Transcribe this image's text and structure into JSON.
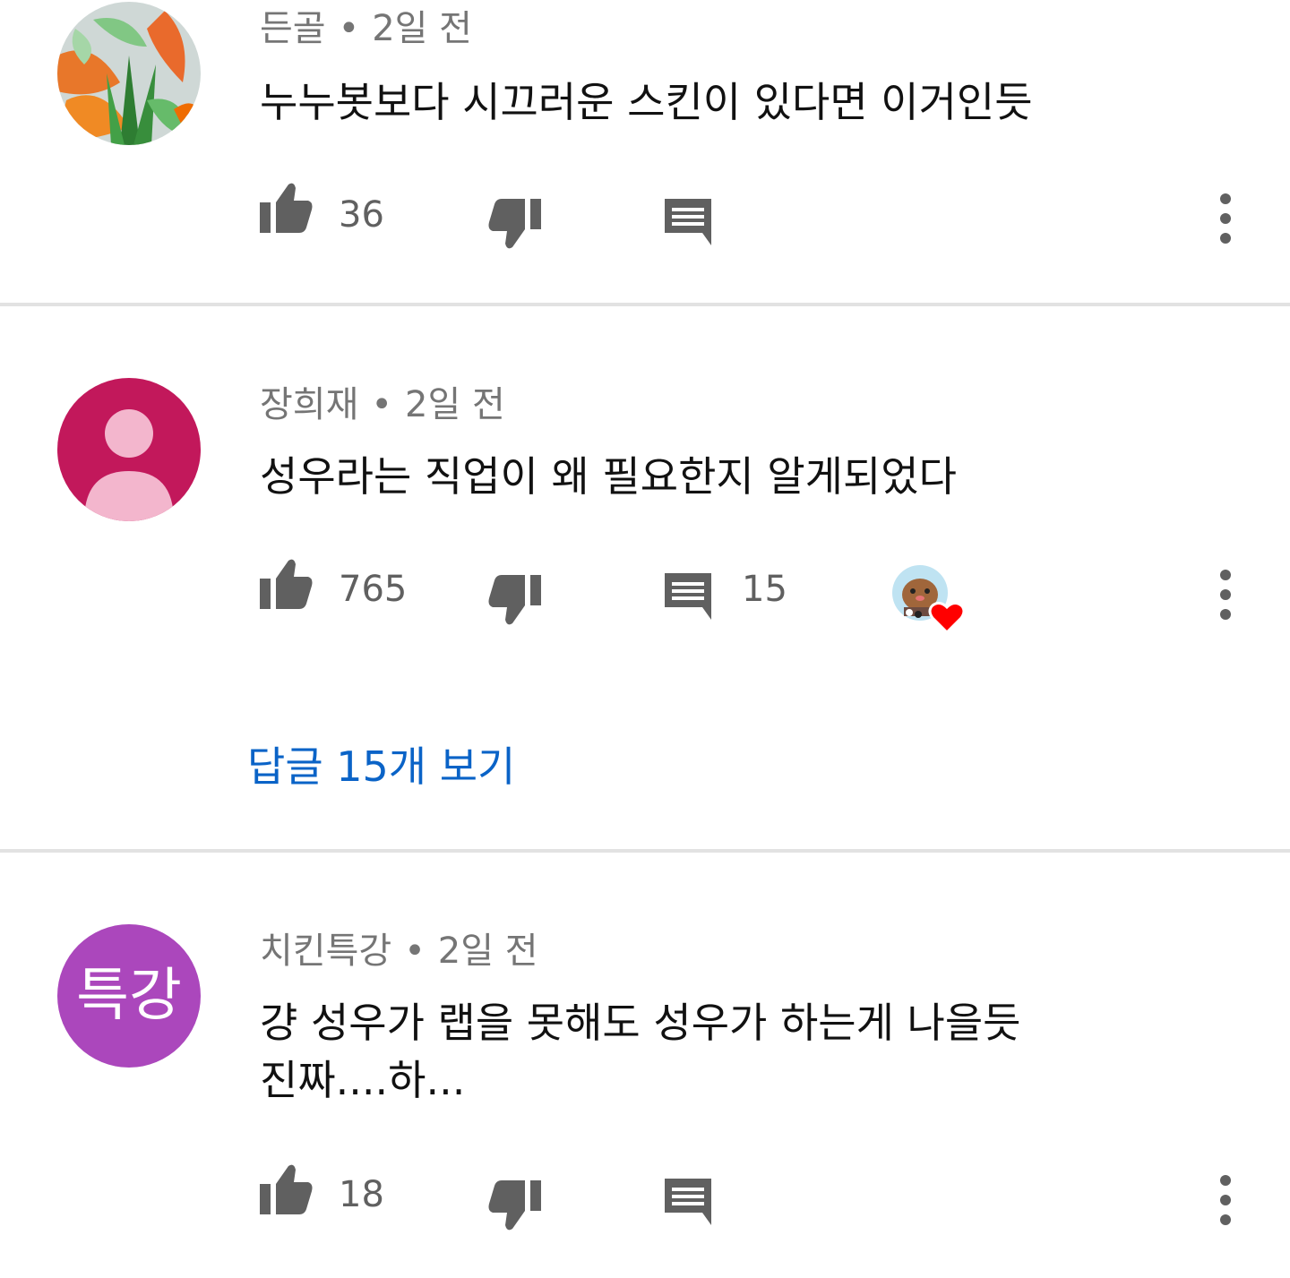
{
  "colors": {
    "icon_gray": "#606060",
    "link_blue": "#0a63c7",
    "divider": "#e2e2e2",
    "heart_red": "#ff0000"
  },
  "comments": [
    {
      "author": "든골",
      "separator": "•",
      "time": "2일 전",
      "text_lines": [
        "누누봇보다 시끄러운 스킨이 있다면 이거인듯"
      ],
      "likes": "36",
      "reply_count": "",
      "avatar_type": "image-leaves"
    },
    {
      "author": "장희재",
      "separator": "•",
      "time": "2일 전",
      "text_lines": [
        "성우라는 직업이 왜 필요한지 알게되었다"
      ],
      "likes": "765",
      "reply_count": "15",
      "avatar_type": "default-person",
      "avatar_color": "#c2185b",
      "hearted_by_creator": true,
      "view_replies_label": "답글 15개 보기"
    },
    {
      "author": "치킨특강",
      "separator": "•",
      "time": "2일 전",
      "text_lines": [
        "걍 성우가 랩을 못해도 성우가 하는게 나을듯",
        "진짜....하..."
      ],
      "likes": "18",
      "reply_count": "",
      "avatar_type": "text",
      "avatar_text": "특강",
      "avatar_color": "#ab47bc"
    }
  ],
  "icons": {
    "like": "thumbs-up-icon",
    "dislike": "thumbs-down-icon",
    "reply": "comment-icon",
    "more": "more-vertical-icon",
    "heart": "heart-icon"
  }
}
